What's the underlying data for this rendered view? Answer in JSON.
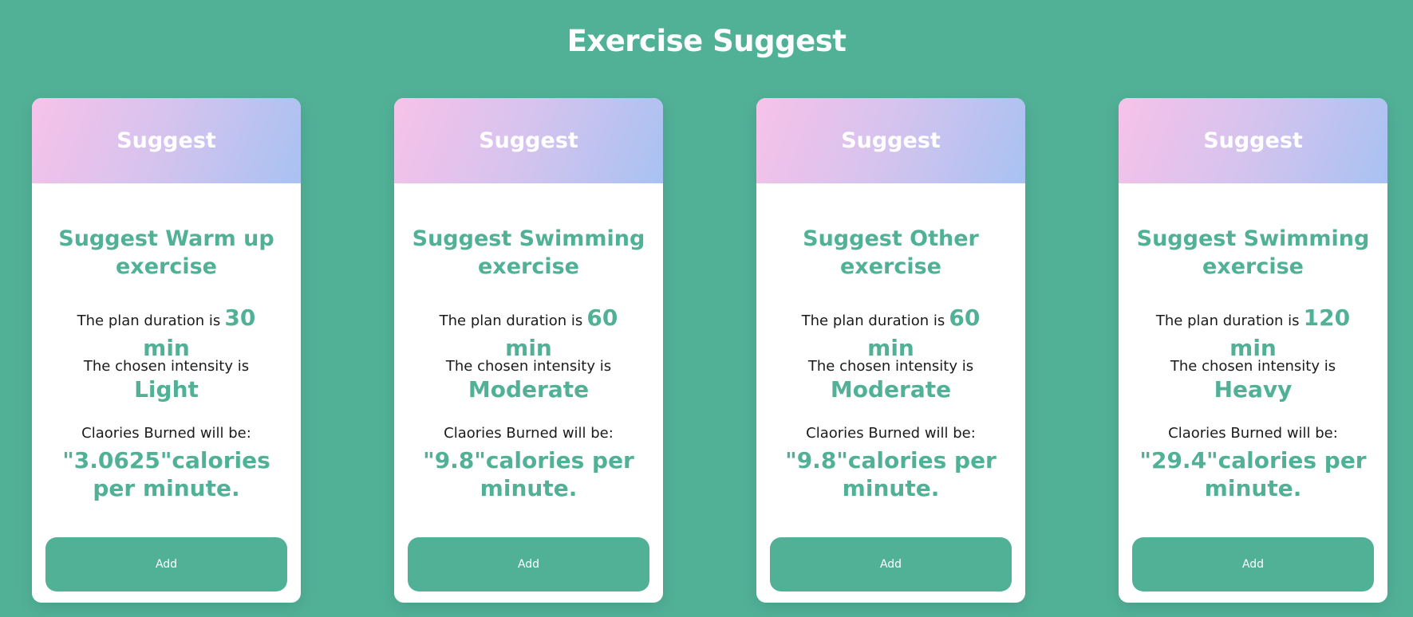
{
  "page": {
    "title": "Exercise Suggest"
  },
  "colors": {
    "background": "#51b197",
    "accent": "#51b197",
    "card": "#ffffff"
  },
  "cards": [
    {
      "header": "Suggest",
      "exercise_title": "Suggest Warm up exercise",
      "duration_label": "The plan duration is",
      "duration_value": "30",
      "duration_unit": "min",
      "intensity_label": "The chosen intensity is",
      "intensity_value": "Light",
      "calories_label": "Claories Burned will be:",
      "calories_value": "\"3.0625\"calories per minute.",
      "button_label": "Add"
    },
    {
      "header": "Suggest",
      "exercise_title": "Suggest Swimming exercise",
      "duration_label": "The plan duration is",
      "duration_value": "60",
      "duration_unit": "min",
      "intensity_label": "The chosen intensity is",
      "intensity_value": "Moderate",
      "calories_label": "Claories Burned will be:",
      "calories_value": "\"9.8\"calories per minute.",
      "button_label": "Add"
    },
    {
      "header": "Suggest",
      "exercise_title": "Suggest Other exercise",
      "duration_label": "The plan duration is",
      "duration_value": "60",
      "duration_unit": "min",
      "intensity_label": "The chosen intensity is",
      "intensity_value": "Moderate",
      "calories_label": "Claories Burned will be:",
      "calories_value": "\"9.8\"calories per minute.",
      "button_label": "Add"
    },
    {
      "header": "Suggest",
      "exercise_title": "Suggest Swimming exercise",
      "duration_label": "The plan duration is",
      "duration_value": "120",
      "duration_unit": "min",
      "intensity_label": "The chosen intensity is",
      "intensity_value": "Heavy",
      "calories_label": "Claories Burned will be:",
      "calories_value": "\"29.4\"calories per minute.",
      "button_label": "Add"
    }
  ]
}
